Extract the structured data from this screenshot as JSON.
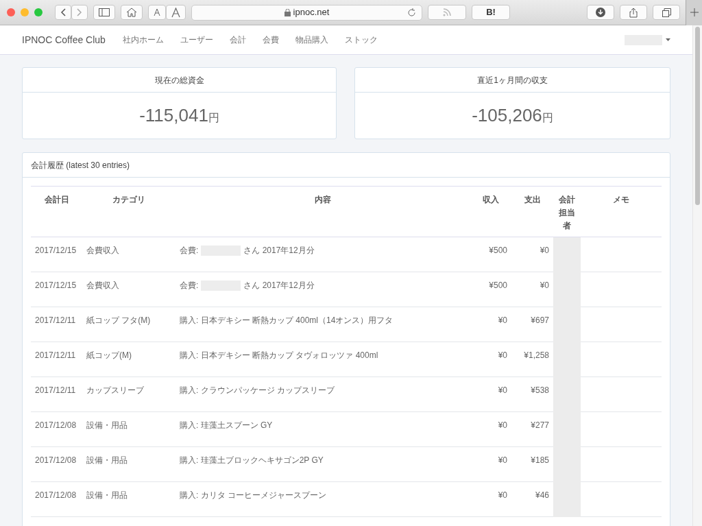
{
  "browser": {
    "address": "ipnoc.net",
    "bookmark_label": "B!"
  },
  "navbar": {
    "brand": "IPNOC Coffee Club",
    "items": [
      {
        "label": "社内ホーム"
      },
      {
        "label": "ユーザー"
      },
      {
        "label": "会計"
      },
      {
        "label": "会費"
      },
      {
        "label": "物品購入"
      },
      {
        "label": "ストック"
      }
    ],
    "user_redacted": true
  },
  "summary_cards": [
    {
      "title": "現在の総資金",
      "amount": "-115,041",
      "unit": "円"
    },
    {
      "title": "直近1ヶ月間の収支",
      "amount": "-105,206",
      "unit": "円"
    }
  ],
  "history": {
    "title": "会計履歴 (latest 30 entries)",
    "columns": [
      "会計日",
      "カテゴリ",
      "内容",
      "収入",
      "支出",
      "会計担当者",
      "メモ"
    ],
    "treasurer_redacted": true,
    "rows": [
      {
        "date": "2017/12/15",
        "category": "会費収入",
        "content": "会費:",
        "redacted": true,
        "content_after": "さん 2017年12月分",
        "income": "¥500",
        "expense": "¥0"
      },
      {
        "date": "2017/12/15",
        "category": "会費収入",
        "content": "会費:",
        "redacted": true,
        "content_after": "さん 2017年12月分",
        "income": "¥500",
        "expense": "¥0"
      },
      {
        "date": "2017/12/11",
        "category": "紙コップ フタ(M)",
        "content": "購入: 日本デキシー 断熱カップ 400ml（14オンス）用フタ",
        "income": "¥0",
        "expense": "¥697"
      },
      {
        "date": "2017/12/11",
        "category": "紙コップ(M)",
        "content": "購入: 日本デキシー 断熱カップ タヴォロッツァ 400ml",
        "income": "¥0",
        "expense": "¥1,258"
      },
      {
        "date": "2017/12/11",
        "category": "カップスリーブ",
        "content": "購入: クラウンパッケージ カップスリーブ",
        "income": "¥0",
        "expense": "¥538"
      },
      {
        "date": "2017/12/08",
        "category": "設備・用品",
        "content": "購入: 珪藻土スプーン GY",
        "income": "¥0",
        "expense": "¥277"
      },
      {
        "date": "2017/12/08",
        "category": "設備・用品",
        "content": "購入: 珪藻土ブロックヘキサゴン2P GY",
        "income": "¥0",
        "expense": "¥185"
      },
      {
        "date": "2017/12/08",
        "category": "設備・用品",
        "content": "購入: カリタ コーヒーメジャースプーン",
        "income": "¥0",
        "expense": "¥46"
      }
    ]
  }
}
